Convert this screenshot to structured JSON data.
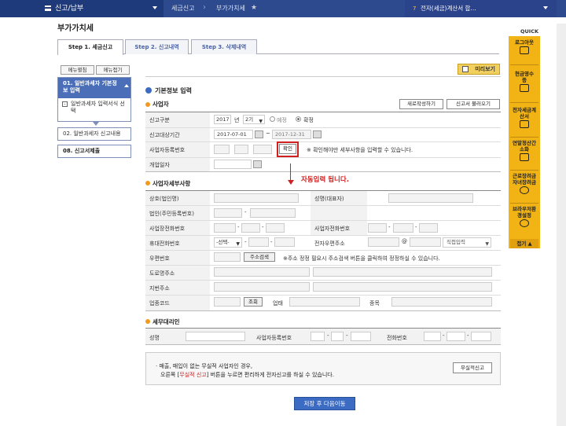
{
  "nav": {
    "menu": "신고/납부",
    "crumb1": "세금신고",
    "crumb2": "부가가치세",
    "right": "전자(세금)계산서 합..."
  },
  "page": {
    "title": "부가가치세"
  },
  "tabs": [
    "Step 1. 세금신고",
    "Step 2. 신고내역",
    "Step 3. 삭제내역"
  ],
  "side": {
    "open": "메뉴펼침",
    "close": "메뉴접기",
    "step1": "01. 일반과세자 기본정보 입력",
    "step1sub": "일반과세자 입력서식 선택",
    "step2": "02. 일반과세자 신고내용",
    "step3": "08. 신고서제출"
  },
  "preview": "미리보기",
  "section": {
    "title": "기본정보 입력",
    "biz": "사업자",
    "new_btn": "새로작성하기",
    "load_btn": "신고서 불러오기"
  },
  "form": {
    "type": "신고구분",
    "year": "2017",
    "year_unit": "년",
    "period": "2기",
    "opt1": "예정",
    "opt2": "확정",
    "range": "신고대상기간",
    "from": "2017-07-01",
    "to": "2017-12-31",
    "bizno": "사업자등록번호",
    "confirm": "확인",
    "confirm_note": "※ 확인해야만 세부사항을 입력할 수 있습니다.",
    "open": "개업일자"
  },
  "auto_note": "자동입력 됩니다.",
  "detail": {
    "title": "사업자세부사항",
    "name": "상호(법인명)",
    "rep": "성명(대표자)",
    "corp": "법인(주민등록번호)",
    "biztel": "사업장전화번호",
    "homtel": "사업자전화번호",
    "mobile": "휴대전화번호",
    "select": "-선택-",
    "email": "전자우편주소",
    "direct": "직접입력",
    "zip": "우편번호",
    "zipbtn": "주소검색",
    "zipnote": "※주소 정정 필요시 주소검색 버튼을 클릭하여 정정하실 수 있습니다.",
    "road": "도로명주소",
    "jibun": "지번주소",
    "code": "업종코드",
    "query": "조회",
    "biztype": "업태",
    "item": "종목"
  },
  "tax": {
    "title": "세무대리인",
    "name": "성명",
    "bizno": "사업자등록번호",
    "tel": "전화번호"
  },
  "notice": {
    "line1": "· 매출, 매입이 없는 무실적 사업자인 경우,",
    "line2a": "오른쪽 [",
    "line2b": "무실적 신고",
    "line2c": "] 버튼을 누르면 편리하게 전자신고를 하실 수 있습니다.",
    "btn": "무실적신고"
  },
  "save": "저장 후 다음이동",
  "quick": {
    "title": "QUICK",
    "items": [
      "로그아웃",
      "현금영수증",
      "전자세금계산서",
      "연말정산간소화",
      "근로장려금자녀장려금",
      "브라우저환경설정"
    ],
    "fold": "접기"
  }
}
